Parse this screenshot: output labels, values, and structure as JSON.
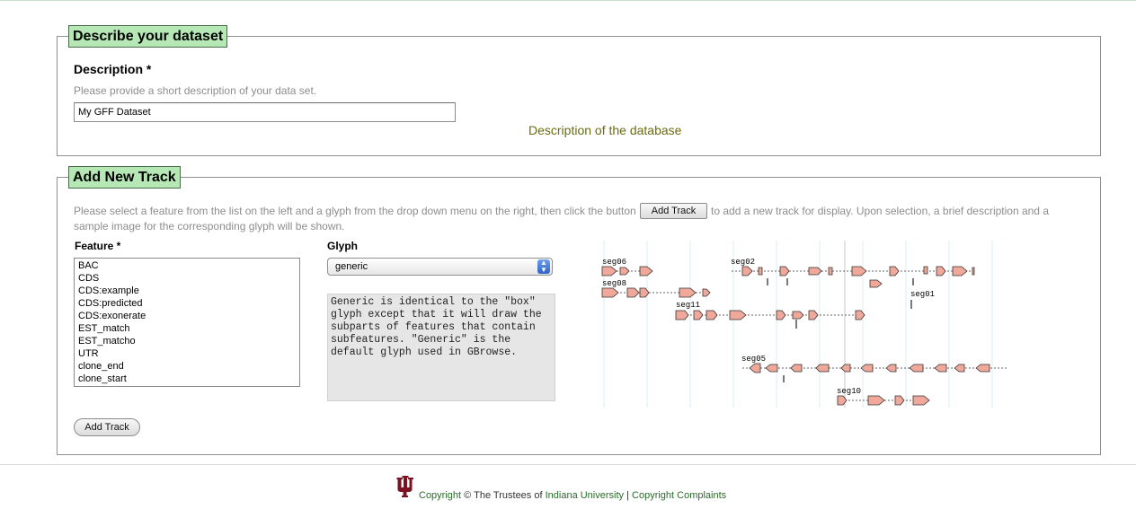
{
  "describe_section": {
    "legend": "Describe your dataset",
    "description_label": "Description *",
    "description_hint": "Please provide a short description of your data set.",
    "description_value": "My GFF Dataset",
    "caption": "Description of the database"
  },
  "track_section": {
    "legend": "Add New Track",
    "instructions_before": "Please select a feature from the list on the left and a glyph from the drop down menu on the right, then click the button",
    "inline_button_label": "Add Track",
    "instructions_after": "to add a new track for display. Upon selection, a brief description and a",
    "instructions_line2": "sample image for the corresponding glyph will be shown.",
    "feature_label": "Feature *",
    "features": [
      "BAC",
      "CDS",
      "CDS:example",
      "CDS:predicted",
      "CDS:exonerate",
      "EST_match",
      "EST_matcho",
      "UTR",
      "clone_end",
      "clone_start"
    ],
    "glyph_label": "Glyph",
    "glyph_selected": "generic",
    "glyph_description": "Generic is identical to the \"box\" glyph except that it will draw the subparts of features that contain subfeatures. \"Generic\" is the default glyph used in GBrowse.",
    "add_track_button": "Add Track",
    "sample_labels": [
      "seg06",
      "seg02",
      "seg08",
      "seg01",
      "seg11",
      "seg05",
      "seg10"
    ]
  },
  "footer": {
    "copyright_link": "Copyright",
    "copyright_text": "© The Trustees of",
    "university_link": "Indiana University",
    "separator": "|",
    "complaints_link": "Copyright Complaints"
  },
  "colors": {
    "legend_bg": "#b5e8b5",
    "caption": "#6b6b12",
    "glyph_fill": "#f0a89a",
    "iu_crimson": "#7d1122"
  },
  "icons": {
    "logo": "iu-trident-logo",
    "select_arrow": "updown-arrows-icon"
  }
}
